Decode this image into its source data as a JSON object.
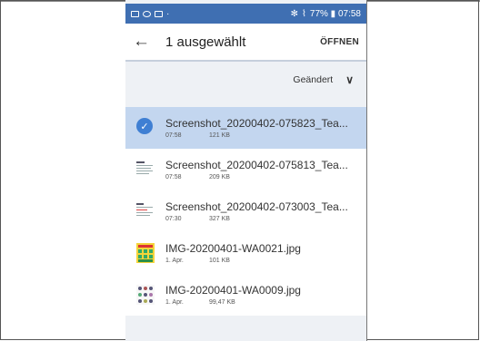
{
  "status_bar": {
    "right_text": "77% ▮ 07:58"
  },
  "app_bar": {
    "back_label": "←",
    "title": "1 ausgewählt",
    "open_label": "ÖFFNEN"
  },
  "sort": {
    "label": "Geändert",
    "chevron": "∨"
  },
  "files": [
    {
      "name": "Screenshot_20200402-075823_Tea...",
      "time": "07:58",
      "size": "121 KB",
      "selected": true,
      "icon": "check-icon"
    },
    {
      "name": "Screenshot_20200402-075813_Tea...",
      "time": "07:58",
      "size": "209 KB",
      "selected": false,
      "icon": "document-thumbnail-icon"
    },
    {
      "name": "Screenshot_20200402-073003_Tea...",
      "time": "07:30",
      "size": "327 KB",
      "selected": false,
      "icon": "document-thumbnail-icon"
    },
    {
      "name": "IMG-20200401-WA0021.jpg",
      "time": "1. Apr.",
      "size": "101 KB",
      "selected": false,
      "icon": "image-thumbnail-icon"
    },
    {
      "name": "IMG-20200401-WA0009.jpg",
      "time": "1. Apr.",
      "size": "99,47 KB",
      "selected": false,
      "icon": "image-thumbnail-icon"
    }
  ],
  "colors": {
    "status_bar": "#3f6fb2",
    "selected_row": "#c3d6ef",
    "check": "#3f7fd3"
  }
}
